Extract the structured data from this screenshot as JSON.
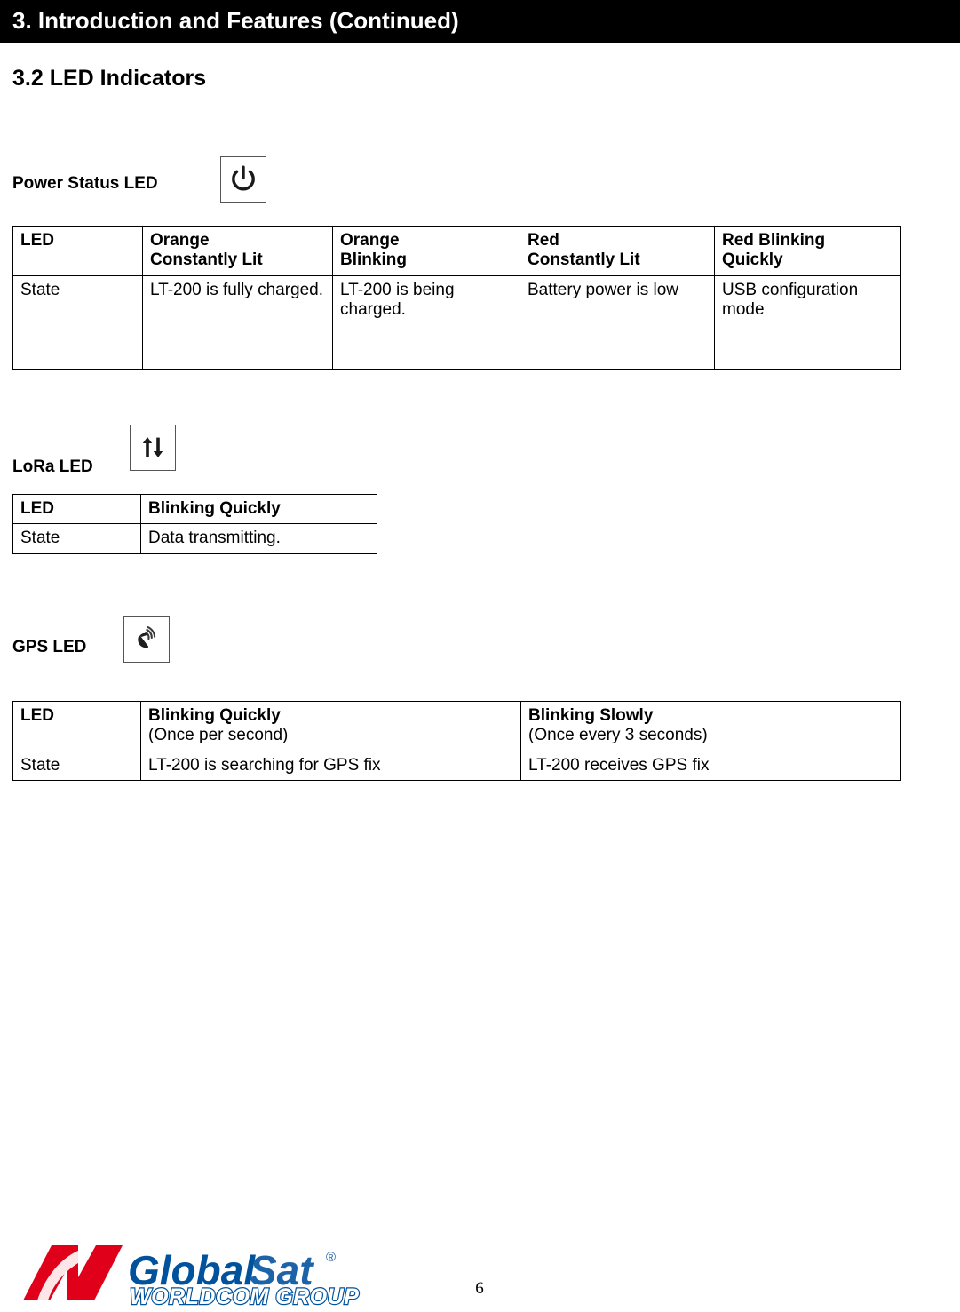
{
  "header": {
    "chapter_title": "3. Introduction and Features (Continued)",
    "banner_color": "#000000"
  },
  "section": {
    "title": "3.2 LED Indicators"
  },
  "colors": {
    "header_cell_pale_yellow": "#FFFF99",
    "header_cell_orange": "#FFC20E",
    "logo_red": "#E1001A",
    "logo_blue_dark": "#00529C",
    "logo_blue_light": "#1C63A8"
  },
  "groups": [
    {
      "label": "Power Status LED",
      "icon": "power-icon",
      "table": {
        "columns": [
          "LED",
          "Orange Constantly Lit",
          "Orange Blinking",
          "Red Constantly Lit",
          "Red Blinking Quickly"
        ],
        "header": {
          "label": "LED",
          "cells": [
            {
              "line1": "Orange",
              "line2": "Constantly Lit"
            },
            {
              "line1": "Orange",
              "line2": "Blinking"
            },
            {
              "line1": "Red",
              "line2": "Constantly Lit"
            },
            {
              "line1": "Red Blinking",
              "line2": "Quickly"
            }
          ]
        },
        "row": {
          "label": "State",
          "cells": [
            "LT-200 is fully charged.",
            "LT-200 is being charged.",
            "Battery power is low",
            "USB configuration mode"
          ]
        }
      }
    },
    {
      "label": "LoRa LED",
      "icon": "up-down-arrows-icon",
      "table": {
        "header": {
          "label": "LED",
          "cells": [
            {
              "line1": "Blinking Quickly",
              "line2": ""
            }
          ]
        },
        "row": {
          "label": "State",
          "cells": [
            "Data transmitting."
          ]
        }
      }
    },
    {
      "label": "GPS LED",
      "icon": "satellite-dish-icon",
      "table": {
        "header": {
          "label": "LED",
          "cells": [
            {
              "line1": "Blinking Quickly",
              "line2": "(Once per second)"
            },
            {
              "line1": "Blinking Slowly",
              "line2": "(Once every 3 seconds)"
            }
          ]
        },
        "row": {
          "label": "State",
          "cells": [
            "LT-200 is searching for GPS fix",
            "LT-200 receives GPS fix"
          ]
        }
      }
    }
  ],
  "footer": {
    "logo": {
      "word1": "Global",
      "word2": "Sat",
      "trademark": "®",
      "tagline": "WORLDCOM GROUP"
    },
    "page_number": "6"
  }
}
